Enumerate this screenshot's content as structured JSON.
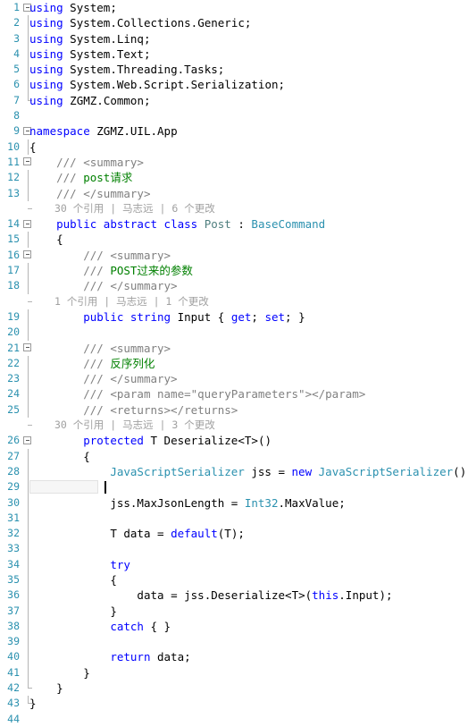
{
  "editor": {
    "language": "csharp",
    "colors": {
      "background": "#ffffff",
      "line_number": "#2b91af",
      "keyword": "#0000ff",
      "type": "#2b91af",
      "class_name": "#4f7f7f",
      "comment": "#808080",
      "comment_text": "#008000",
      "codelens": "#a0a0a0",
      "current_line_border": "#e2e2e2",
      "fold_marker": "#9a9a9a"
    },
    "current_line": 29,
    "total_lines": 44
  },
  "lines": [
    {
      "n": "1",
      "fold": "open",
      "text": "using System;"
    },
    {
      "n": "2",
      "fold": "bar",
      "text": "using System.Collections.Generic;"
    },
    {
      "n": "3",
      "fold": "bar",
      "text": "using System.Linq;"
    },
    {
      "n": "4",
      "fold": "bar",
      "text": "using System.Text;"
    },
    {
      "n": "5",
      "fold": "bar",
      "text": "using System.Threading.Tasks;"
    },
    {
      "n": "6",
      "fold": "bar",
      "text": "using System.Web.Script.Serialization;"
    },
    {
      "n": "7",
      "fold": "end",
      "text": "using ZGMZ.Common;"
    },
    {
      "n": "8",
      "fold": "none",
      "text": ""
    },
    {
      "n": "9",
      "fold": "open",
      "text": "namespace ZGMZ.UIL.App"
    },
    {
      "n": "10",
      "fold": "bar",
      "text": "{"
    },
    {
      "n": "11",
      "fold": "open2",
      "text": "    /// <summary>"
    },
    {
      "n": "12",
      "fold": "bar",
      "text": "    /// post请求"
    },
    {
      "n": "13",
      "fold": "bar",
      "text": "    /// </summary>"
    },
    {
      "n": "14",
      "fold": "open2",
      "text": "    public abstract class Post : BaseCommand"
    },
    {
      "n": "15",
      "fold": "bar",
      "text": "    {"
    },
    {
      "n": "16",
      "fold": "open2",
      "text": "        /// <summary>"
    },
    {
      "n": "17",
      "fold": "bar",
      "text": "        /// POST过来的参数"
    },
    {
      "n": "18",
      "fold": "bar",
      "text": "        /// </summary>"
    },
    {
      "n": "19",
      "fold": "bar",
      "text": "        public string Input { get; set; }"
    },
    {
      "n": "20",
      "fold": "bar",
      "text": ""
    },
    {
      "n": "21",
      "fold": "open2",
      "text": "        /// <summary>"
    },
    {
      "n": "22",
      "fold": "bar",
      "text": "        /// 反序列化"
    },
    {
      "n": "23",
      "fold": "bar",
      "text": "        /// </summary>"
    },
    {
      "n": "24",
      "fold": "bar",
      "text": "        /// <param name=\"queryParameters\"></param>"
    },
    {
      "n": "25",
      "fold": "bar",
      "text": "        /// <returns></returns>"
    },
    {
      "n": "26",
      "fold": "open2",
      "text": "        protected T Deserialize<T>()"
    },
    {
      "n": "27",
      "fold": "bar",
      "text": "        {"
    },
    {
      "n": "28",
      "fold": "bar",
      "text": "            JavaScriptSerializer jss = new JavaScriptSerializer();"
    },
    {
      "n": "29",
      "fold": "bar",
      "text": ""
    },
    {
      "n": "30",
      "fold": "bar",
      "text": "            jss.MaxJsonLength = Int32.MaxValue;"
    },
    {
      "n": "31",
      "fold": "bar",
      "text": ""
    },
    {
      "n": "32",
      "fold": "bar",
      "text": "            T data = default(T);"
    },
    {
      "n": "33",
      "fold": "bar",
      "text": ""
    },
    {
      "n": "34",
      "fold": "bar",
      "text": "            try"
    },
    {
      "n": "35",
      "fold": "bar",
      "text": "            {"
    },
    {
      "n": "36",
      "fold": "bar",
      "text": "                data = jss.Deserialize<T>(this.Input);"
    },
    {
      "n": "37",
      "fold": "bar",
      "text": "            }"
    },
    {
      "n": "38",
      "fold": "bar",
      "text": "            catch { }"
    },
    {
      "n": "39",
      "fold": "bar",
      "text": ""
    },
    {
      "n": "40",
      "fold": "bar",
      "text": "            return data;"
    },
    {
      "n": "41",
      "fold": "bar",
      "text": "        }"
    },
    {
      "n": "42",
      "fold": "end",
      "text": "    }"
    },
    {
      "n": "43",
      "fold": "end",
      "text": "}"
    },
    {
      "n": "44",
      "fold": "none",
      "text": ""
    }
  ],
  "codelens": [
    {
      "after_line": "13",
      "references": "30 个引用",
      "author": "马志远",
      "changes": "6 个更改"
    },
    {
      "after_line": "18",
      "references": "1 个引用",
      "author": "马志远",
      "changes": "1 个更改"
    },
    {
      "after_line": "25",
      "references": "30 个引用",
      "author": "马志远",
      "changes": "3 个更改"
    }
  ],
  "tokens": {
    "keywords": [
      "using",
      "namespace",
      "public",
      "abstract",
      "class",
      "string",
      "get",
      "set",
      "protected",
      "new",
      "default",
      "try",
      "catch",
      "return",
      "this"
    ],
    "types": [
      "Int32",
      "JavaScriptSerializer",
      "BaseCommand"
    ],
    "classes": [
      "Post"
    ]
  },
  "icons": {
    "fold_collapse": "minus-box-icon",
    "caret": "text-caret-icon"
  }
}
